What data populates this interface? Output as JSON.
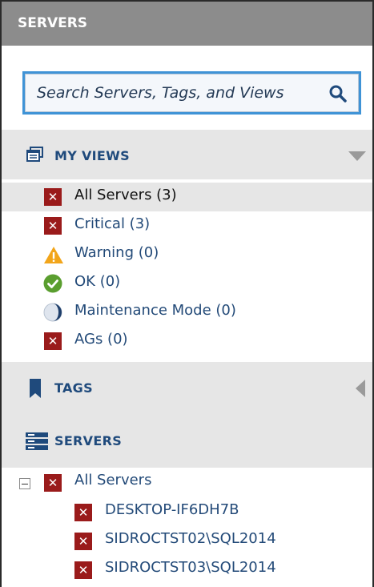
{
  "header": {
    "title": "SERVERS"
  },
  "search": {
    "placeholder": "Search Servers, Tags, and Views"
  },
  "my_views": {
    "title": "MY VIEWS",
    "items": [
      {
        "label": "All Servers (3)",
        "status": "critical",
        "selected": true
      },
      {
        "label": "Critical (3)",
        "status": "critical"
      },
      {
        "label": "Warning (0)",
        "status": "warning"
      },
      {
        "label": "OK (0)",
        "status": "ok"
      },
      {
        "label": "Maintenance Mode (0)",
        "status": "maintenance"
      },
      {
        "label": "AGs (0)",
        "status": "critical"
      }
    ]
  },
  "tags": {
    "title": "TAGS"
  },
  "servers": {
    "title": "SERVERS",
    "tree": {
      "root": {
        "label": "All Servers",
        "status": "critical",
        "expanded": true
      },
      "children": [
        {
          "label": "DESKTOP-IF6DH7B",
          "status": "critical"
        },
        {
          "label": "SIDROCTST02\\SQL2014",
          "status": "critical"
        },
        {
          "label": "SIDROCTST03\\SQL2014",
          "status": "critical"
        }
      ]
    }
  },
  "colors": {
    "header_bg": "#8c8c8c",
    "section_bg": "#e6e6e6",
    "critical": "#9a1b1b",
    "warning": "#f2a51a",
    "ok": "#5a9e2f",
    "link_text": "#234a78",
    "accent": "#3f93d6"
  },
  "icons": {
    "search": "search-icon",
    "my_views": "views-window-icon",
    "tags": "bookmark-icon",
    "servers": "server-stack-icon",
    "collapse_views": "triangle-down-icon",
    "expand_tags": "triangle-left-icon"
  }
}
